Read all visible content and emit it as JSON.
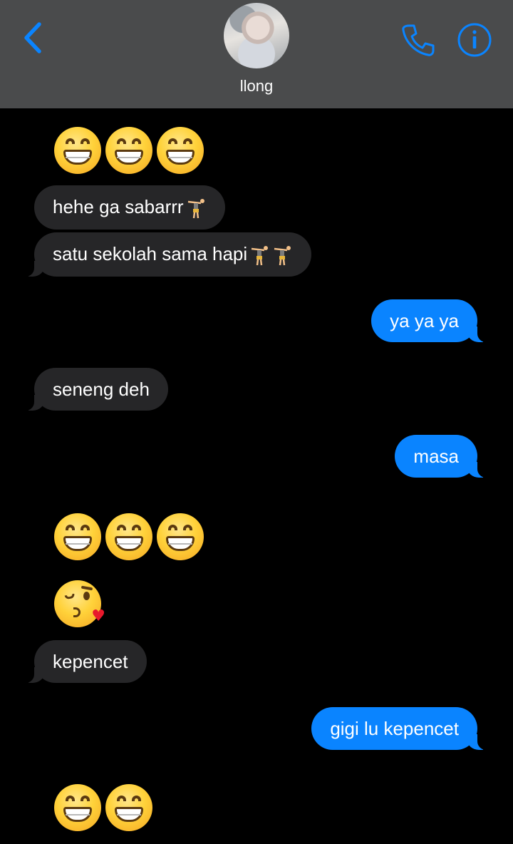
{
  "header": {
    "contact_name": "llong",
    "accent_color": "#0a84ff",
    "icons": [
      "chevron-left-icon",
      "phone-icon",
      "info-icon"
    ]
  },
  "colors": {
    "incoming_bubble": "#262628",
    "outgoing_bubble": "#0a84ff",
    "background": "#000000",
    "header_background": "#4a4b4c"
  },
  "messages": [
    {
      "from": "them",
      "type": "emoji",
      "emoji": "grinning-face-with-smiling-eyes",
      "count": 3
    },
    {
      "from": "them",
      "type": "text",
      "text": "hehe ga sabarrr",
      "trailing_emoji": "person-cartwheeling"
    },
    {
      "from": "them",
      "type": "text",
      "text": "satu sekolah sama hapi",
      "trailing_emoji": "person-cartwheeling x2"
    },
    {
      "from": "me",
      "type": "text",
      "text": "ya ya ya"
    },
    {
      "from": "them",
      "type": "text",
      "text": "seneng deh"
    },
    {
      "from": "me",
      "type": "text",
      "text": "masa"
    },
    {
      "from": "them",
      "type": "emoji",
      "emoji": "grinning-face-with-smiling-eyes",
      "count": 3
    },
    {
      "from": "them",
      "type": "emoji",
      "emoji": "face-blowing-a-kiss",
      "count": 1
    },
    {
      "from": "them",
      "type": "text",
      "text": "kepencet"
    },
    {
      "from": "me",
      "type": "text",
      "text": "gigi lu kepencet"
    },
    {
      "from": "them",
      "type": "emoji",
      "emoji": "grinning-face-with-smiling-eyes",
      "count": 2
    }
  ]
}
